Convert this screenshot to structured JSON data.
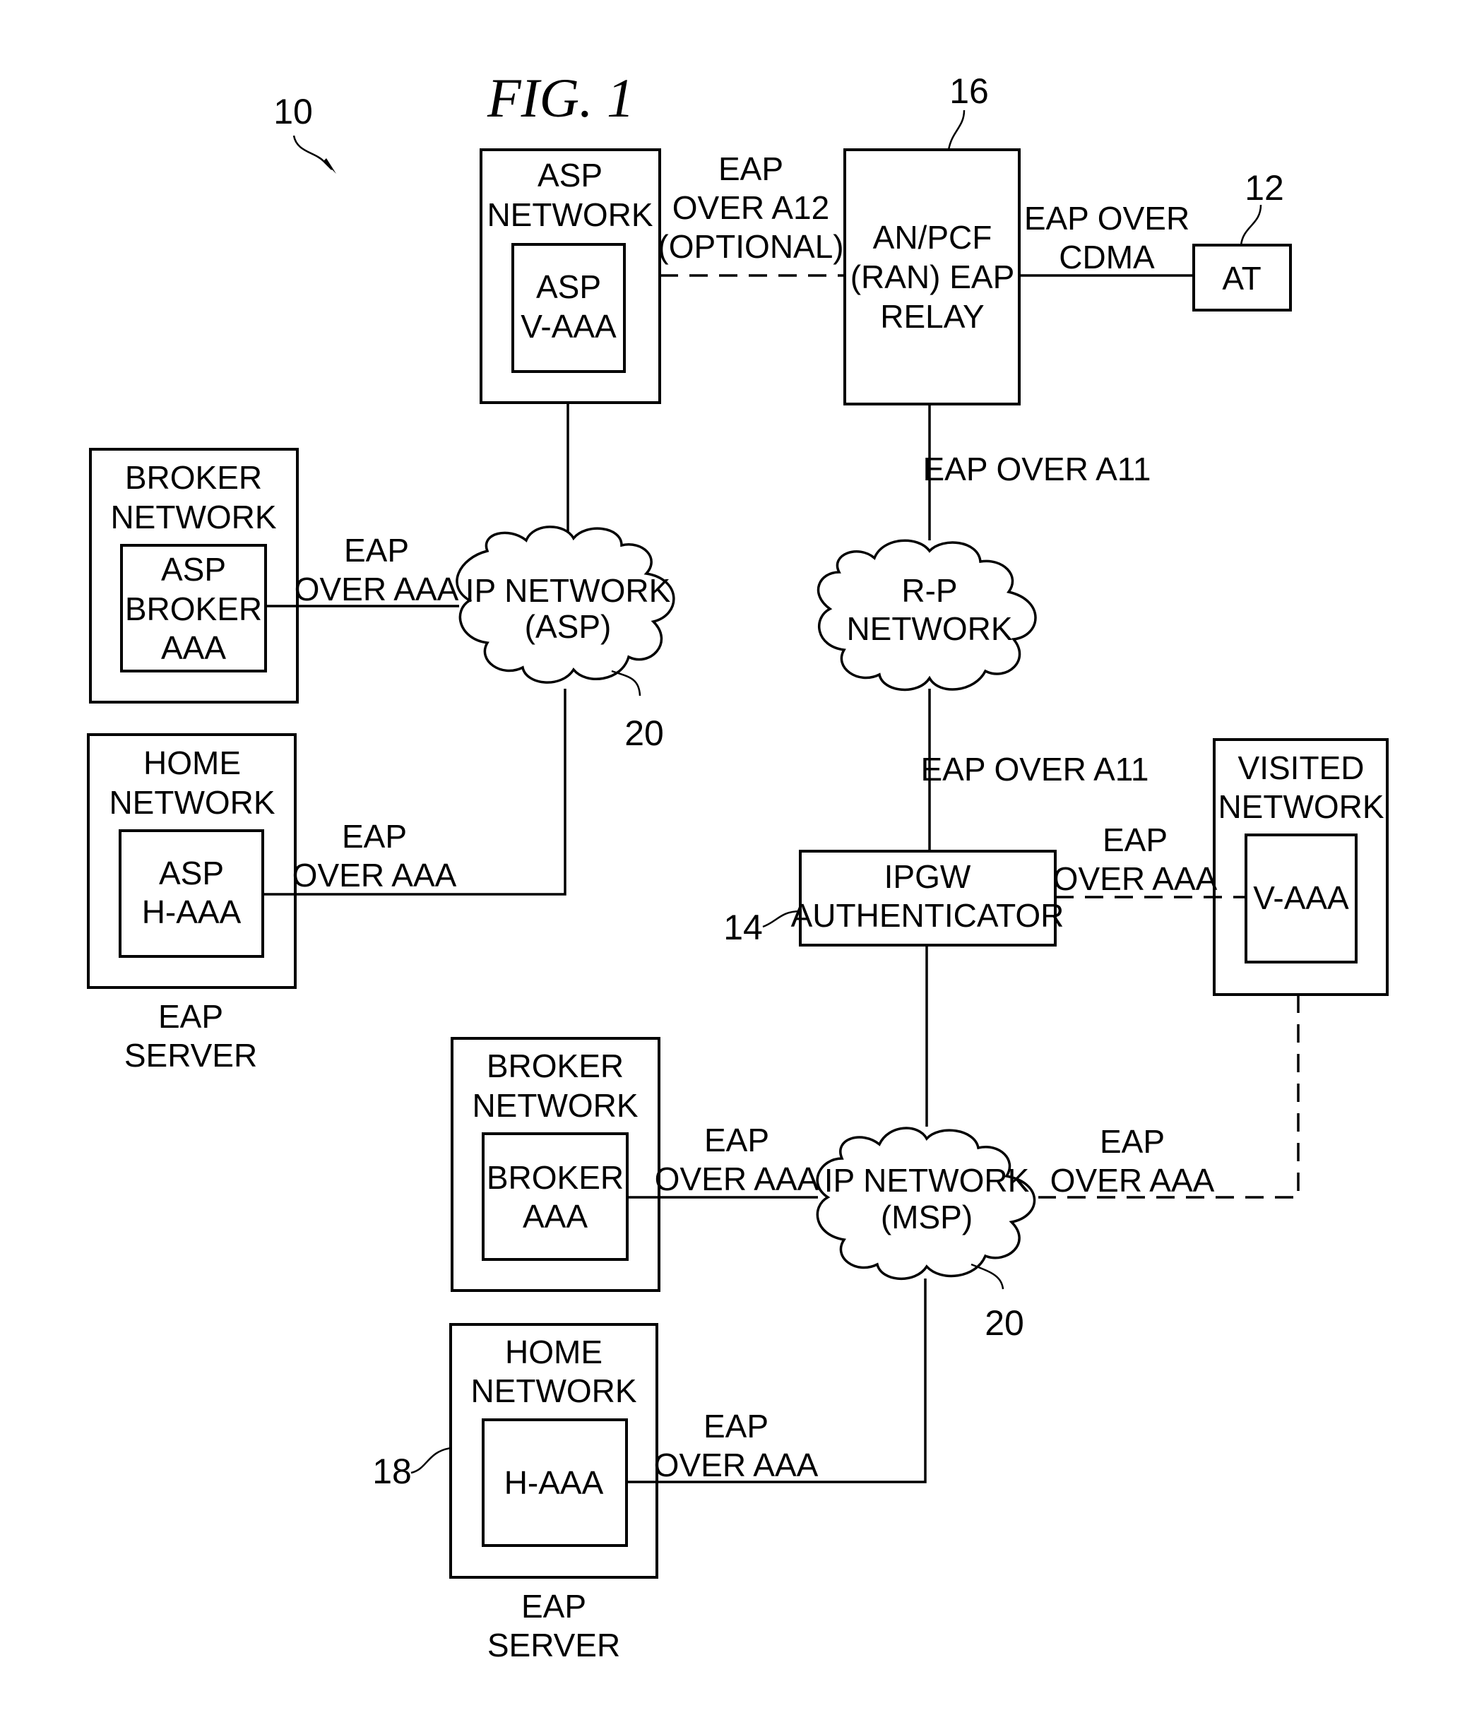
{
  "figure": {
    "title": "FIG. 1",
    "ref_system": "10"
  },
  "nodes": {
    "asp_network": {
      "title": [
        "ASP",
        "NETWORK"
      ],
      "inner": [
        "ASP",
        "V-AAA"
      ]
    },
    "an_pcf": {
      "lines": [
        "AN/PCF",
        "(RAN) EAP",
        "RELAY"
      ],
      "ref": "16"
    },
    "at": {
      "label": "AT",
      "ref": "12"
    },
    "broker_network_asp": {
      "title": [
        "BROKER",
        "NETWORK"
      ],
      "inner": [
        "ASP",
        "BROKER",
        "AAA"
      ]
    },
    "home_network_asp": {
      "title": [
        "HOME",
        "NETWORK"
      ],
      "inner": [
        "ASP",
        "H-AAA"
      ],
      "caption": [
        "EAP",
        "SERVER"
      ]
    },
    "ip_network_asp": {
      "lines": [
        "IP NETWORK",
        "(ASP)"
      ],
      "ref": "20"
    },
    "rp_network": {
      "lines": [
        "R-P",
        "NETWORK"
      ]
    },
    "ipgw": {
      "lines": [
        "IPGW",
        "AUTHENTICATOR"
      ],
      "ref": "14"
    },
    "visited_network": {
      "title": [
        "VISITED",
        "NETWORK"
      ],
      "inner": [
        "V-AAA"
      ]
    },
    "broker_network_msp": {
      "title": [
        "BROKER",
        "NETWORK"
      ],
      "inner": [
        "BROKER",
        "AAA"
      ]
    },
    "ip_network_msp": {
      "lines": [
        "IP NETWORK",
        "(MSP)"
      ],
      "ref": "20"
    },
    "home_network_msp": {
      "title": [
        "HOME",
        "NETWORK"
      ],
      "inner": [
        "H-AAA"
      ],
      "caption": [
        "EAP",
        "SERVER"
      ],
      "ref": "18"
    }
  },
  "links": {
    "asp_to_anpcf": [
      "EAP",
      "OVER A12",
      "(OPTIONAL)"
    ],
    "anpcf_to_at": [
      "EAP OVER",
      "CDMA"
    ],
    "anpcf_to_rp": [
      "EAP OVER A11"
    ],
    "rp_to_ipgw": [
      "EAP OVER A11"
    ],
    "broker_to_ipasp": [
      "EAP",
      "OVER AAA"
    ],
    "home_to_ipasp": [
      "EAP",
      "OVER AAA"
    ],
    "ipgw_to_visited": [
      "EAP",
      "OVER AAA"
    ],
    "broker_to_ipmsp": [
      "EAP",
      "OVER AAA"
    ],
    "visited_to_ipmsp": [
      "EAP",
      "OVER AAA"
    ],
    "home_to_ipmsp": [
      "EAP",
      "OVER AAA"
    ]
  }
}
